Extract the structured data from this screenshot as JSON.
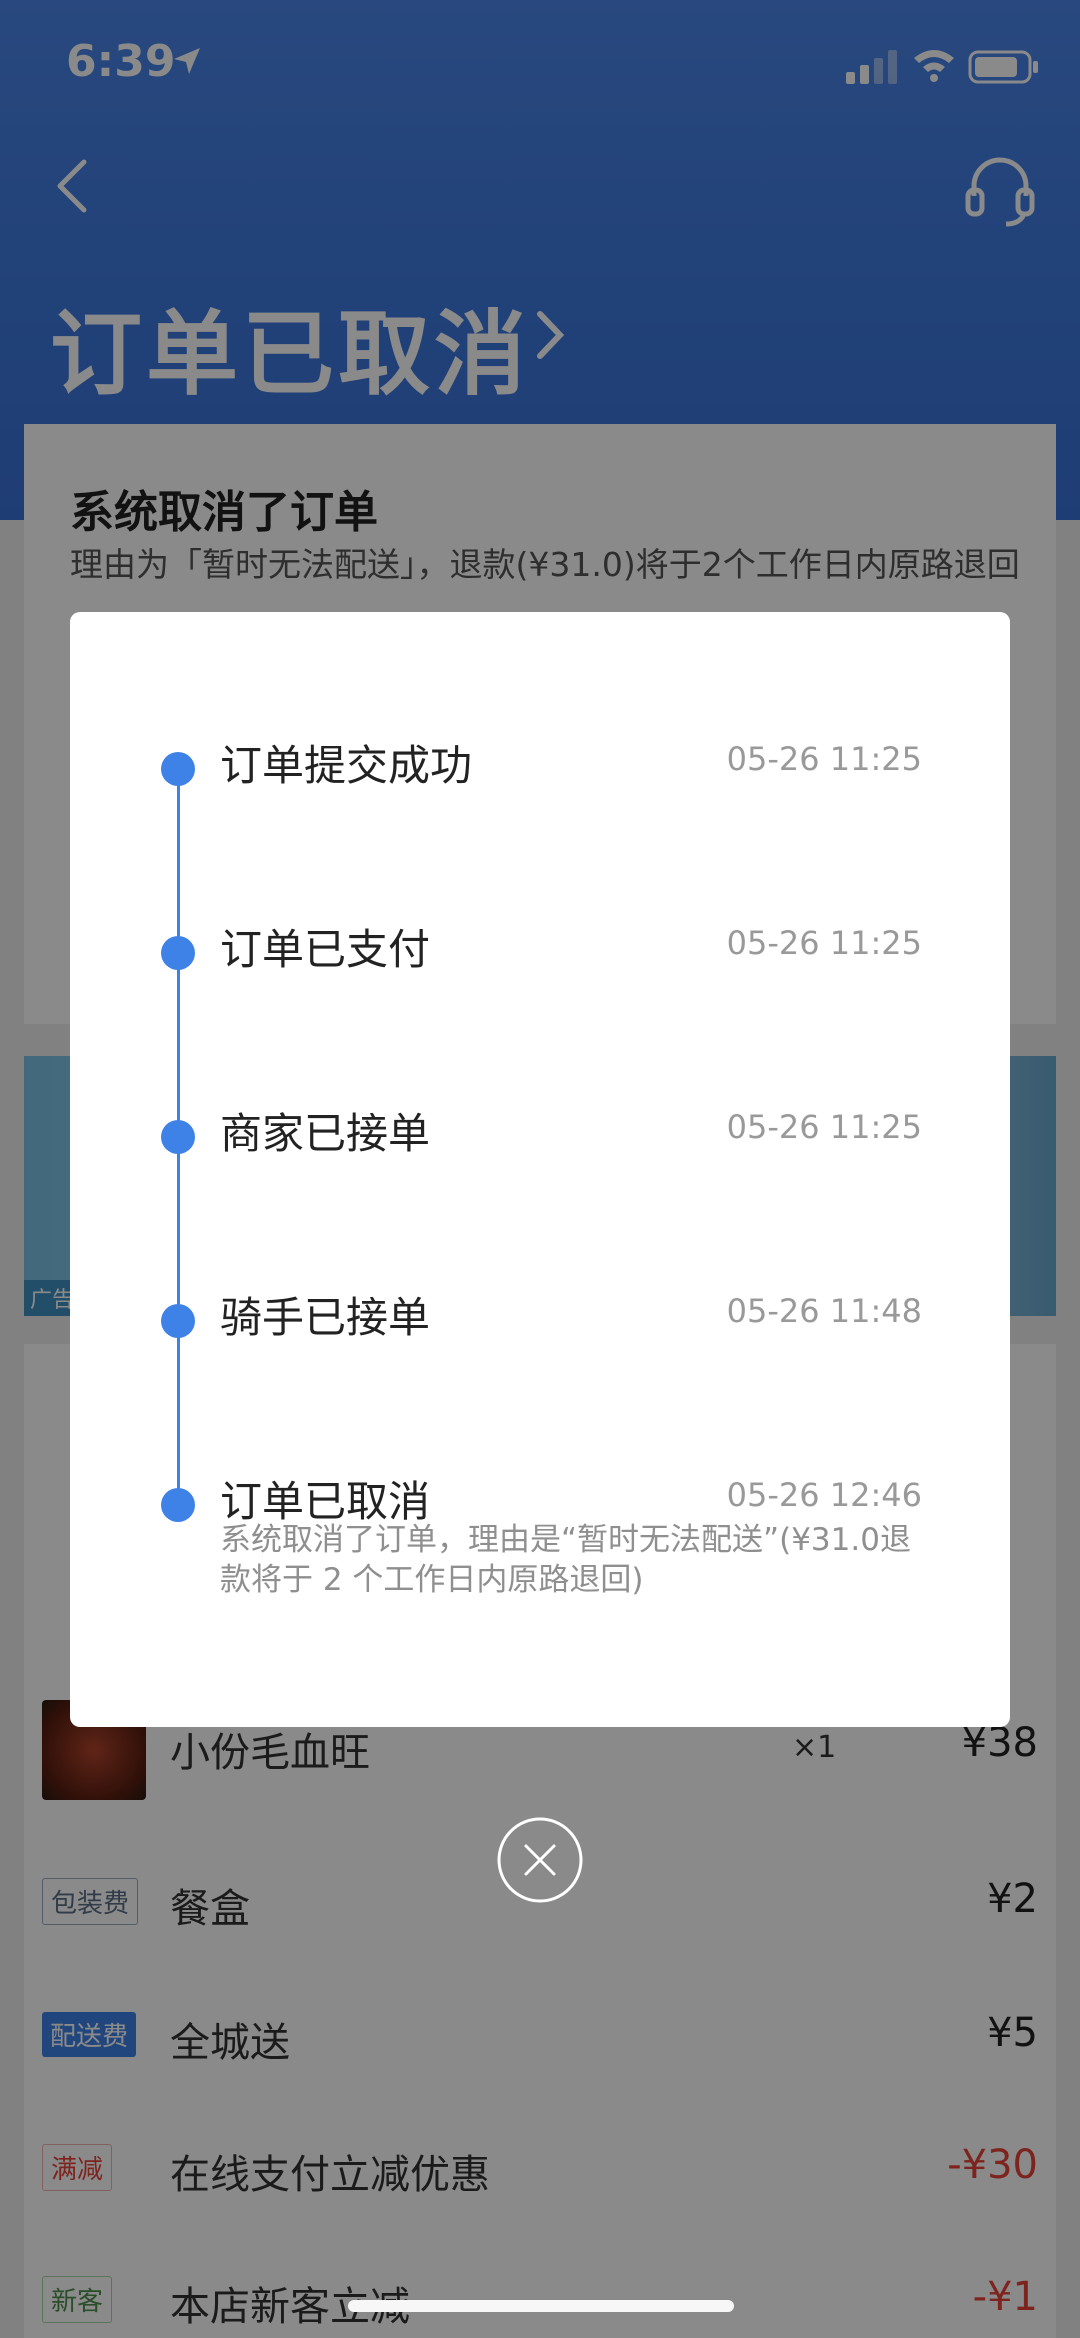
{
  "status_bar": {
    "time": "6:39"
  },
  "header": {
    "title": "订单已取消"
  },
  "cancel_card": {
    "title": "系统取消了订单",
    "reason": "理由为「暂时无法配送」，退款(¥31.0)将于2个工作日内原路退回"
  },
  "ad": {
    "label": "广告"
  },
  "order_items": [
    {
      "name": "小份毛血旺",
      "qty": "×1",
      "price": "¥38"
    },
    {
      "tag": "包装费",
      "name": "餐盒",
      "price": "¥2"
    },
    {
      "tag": "配送费",
      "name": "全城送",
      "price": "¥5"
    },
    {
      "tag": "满减",
      "name": "在线支付立减优惠",
      "price": "-¥30"
    },
    {
      "tag": "新客",
      "name": "本店新客立减",
      "price": "-¥1"
    }
  ],
  "colors": {
    "accent": "#3e82e7",
    "discount": "#e8443a"
  },
  "timeline": [
    {
      "label": "订单提交成功",
      "time": "05-26 11:25"
    },
    {
      "label": "订单已支付",
      "time": "05-26 11:25"
    },
    {
      "label": "商家已接单",
      "time": "05-26 11:25"
    },
    {
      "label": "骑手已接单",
      "time": "05-26 11:48"
    },
    {
      "label": "订单已取消",
      "time": "05-26 12:46",
      "desc": "系统取消了订单，理由是“暂时无法配送”(¥31.0退款将于 2 个工作日内原路退回)"
    }
  ],
  "icons": {
    "back": "chevron-left-icon",
    "service": "headset-icon",
    "close": "close-circle-icon"
  }
}
